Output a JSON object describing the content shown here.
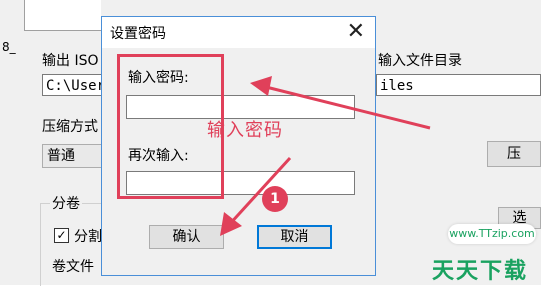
{
  "background": {
    "left_fragment": "8_",
    "output_label": "输出 ISO",
    "output_path_value": "C:\\User",
    "input_dir_label": "输入文件目录",
    "input_dir_value": "iles",
    "compress_label": "压缩方式",
    "compress_selected": "普通",
    "right_button_label": "压",
    "right_button2_label": "选",
    "split_group_label": "分卷",
    "split_checkbox_label": "分割",
    "volume_file_label": "卷文件"
  },
  "dialog": {
    "title": "设置密码",
    "close_symbol": "✕",
    "password_label": "输入密码:",
    "password_value": "",
    "confirm_label": "再次输入:",
    "confirm_value": "",
    "ok_button": "确认",
    "cancel_button": "取消"
  },
  "annotations": {
    "hint_text": "输入密码",
    "step_number": "1",
    "color": "#e0405a"
  },
  "watermark": {
    "url": "www.TTzip.com",
    "brand": "天天下载",
    "color": "#1aa260"
  }
}
